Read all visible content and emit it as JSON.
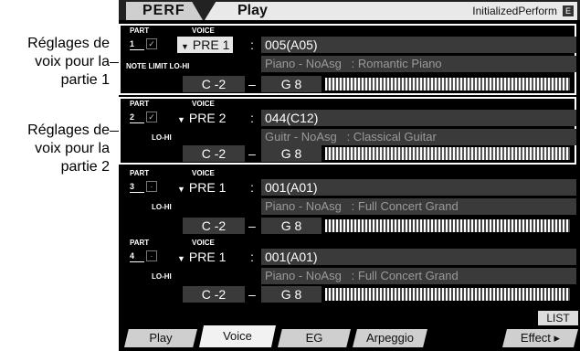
{
  "callouts": {
    "part1": "Réglages de voix pour la partie 1",
    "part2": "Réglages de voix pour la partie 2"
  },
  "header": {
    "tab": "PERF",
    "title": "Play",
    "perf_name": "InitializedPerform",
    "edit_icon": "E"
  },
  "labels": {
    "part": "PART",
    "voice": "VOICE",
    "note_limit": "NOTE LIMIT LO-HI",
    "lohi": "LO-HI"
  },
  "parts": [
    {
      "num": "1",
      "checked": "✓",
      "bank": "PRE 1",
      "voice_num": "005(A05)",
      "voice_name": "Piano - NoAsg   : Romantic Piano",
      "lo": "C -2",
      "hi": "G  8"
    },
    {
      "num": "2",
      "checked": "✓",
      "bank": "PRE 2",
      "voice_num": "044(C12)",
      "voice_name": "Guitr - NoAsg   : Classical Guitar",
      "lo": "C -2",
      "hi": "G  8"
    },
    {
      "num": "3",
      "checked": "·",
      "bank": "PRE 1",
      "voice_num": "001(A01)",
      "voice_name": "Piano - NoAsg   : Full Concert Grand",
      "lo": "C -2",
      "hi": "G  8"
    },
    {
      "num": "4",
      "checked": "·",
      "bank": "PRE 1",
      "voice_num": "001(A01)",
      "voice_name": "Piano - NoAsg   : Full Concert Grand",
      "lo": "C -2",
      "hi": "G  8"
    }
  ],
  "bottom": {
    "list": "LIST",
    "tabs": [
      "Play",
      "Voice",
      "EG",
      "Arpeggio",
      "Effect ▸"
    ]
  }
}
